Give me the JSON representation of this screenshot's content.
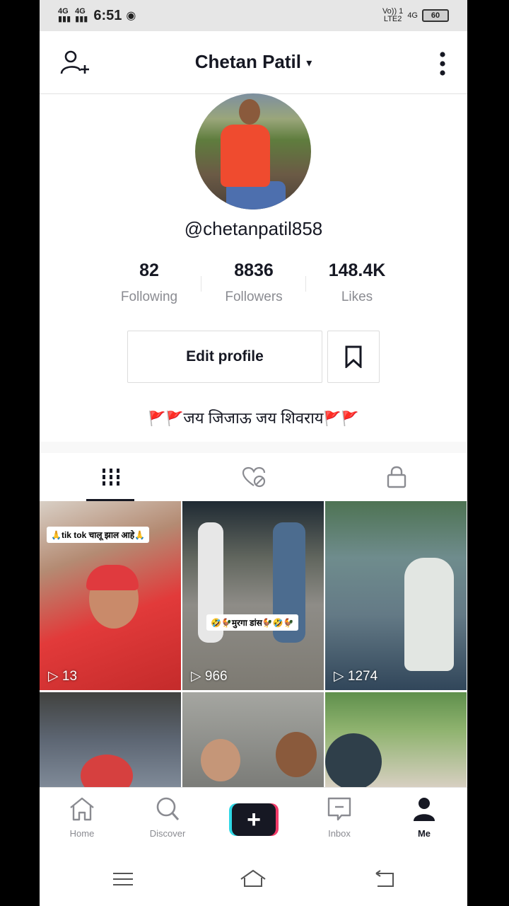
{
  "status_bar": {
    "network_left_1": "4G",
    "network_left_2": "4G",
    "time": "6:51",
    "right_volte": "Vo)) 1",
    "right_lte": "LTE2",
    "right_4g": "4G",
    "battery": "60"
  },
  "header": {
    "title": "Chetan Patil",
    "caret": "▾"
  },
  "profile": {
    "handle": "@chetanpatil858",
    "stats": [
      {
        "value": "82",
        "label": "Following"
      },
      {
        "value": "8836",
        "label": "Followers"
      },
      {
        "value": "148.4K",
        "label": "Likes"
      }
    ],
    "edit_button": "Edit profile",
    "bio_text": "जय जिजाऊ जय शिवराय"
  },
  "tabs": [
    "videos-tab",
    "liked-tab",
    "private-tab"
  ],
  "videos": [
    {
      "views": "13",
      "caption": "🙏tik tok चालू झाल आहे🙏"
    },
    {
      "views": "966",
      "caption": "🤣🐓मुरगा डांस🐓🤣🐓"
    },
    {
      "views": "1274",
      "caption": ""
    },
    {
      "views": "",
      "caption": ""
    },
    {
      "views": "",
      "caption": ""
    },
    {
      "views": "",
      "caption": ""
    }
  ],
  "bottom_nav": [
    {
      "label": "Home",
      "icon": "home-icon"
    },
    {
      "label": "Discover",
      "icon": "search-icon"
    },
    {
      "label": "",
      "icon": "plus-icon"
    },
    {
      "label": "Inbox",
      "icon": "inbox-icon"
    },
    {
      "label": "Me",
      "icon": "person-icon"
    }
  ],
  "colors": {
    "text_primary": "#161823",
    "text_secondary": "#8a8b91",
    "accent_cyan": "#2fd8e6",
    "accent_pink": "#f23a68",
    "flag_red": "#e53a2e"
  }
}
